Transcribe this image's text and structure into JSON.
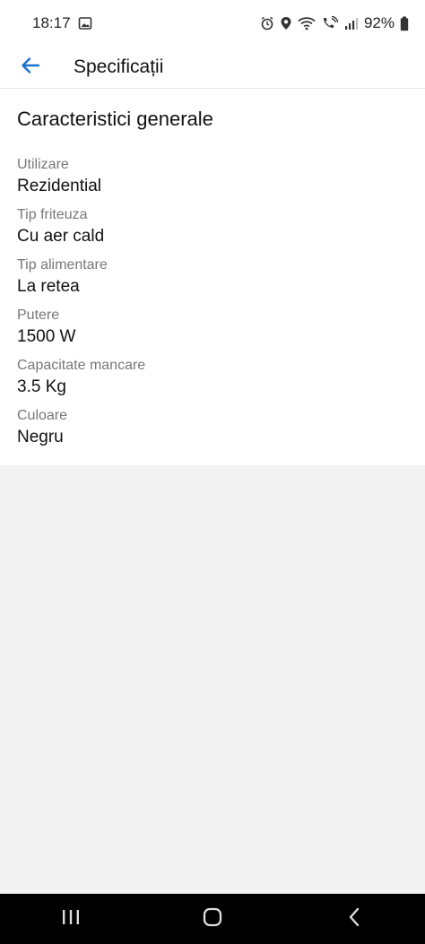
{
  "status_bar": {
    "time": "18:17",
    "battery": "92%",
    "icons": [
      "image-icon",
      "alarm-icon",
      "location-icon",
      "wifi-icon",
      "wifi-calling-icon",
      "signal-icon",
      "battery-icon"
    ]
  },
  "app_bar": {
    "title": "Specificații",
    "back_icon": "back-arrow-icon",
    "accent_color": "#1a73c8"
  },
  "section": {
    "title": "Caracteristici generale",
    "specs": [
      {
        "label": "Utilizare",
        "value": "Rezidential"
      },
      {
        "label": "Tip friteuza",
        "value": "Cu aer cald"
      },
      {
        "label": "Tip alimentare",
        "value": "La retea"
      },
      {
        "label": "Putere",
        "value": "1500 W"
      },
      {
        "label": "Capacitate mancare",
        "value": "3.5 Kg"
      },
      {
        "label": "Culoare",
        "value": "Negru"
      }
    ]
  },
  "nav_bar": {
    "icons": [
      "recents-icon",
      "home-icon",
      "back-icon"
    ]
  }
}
